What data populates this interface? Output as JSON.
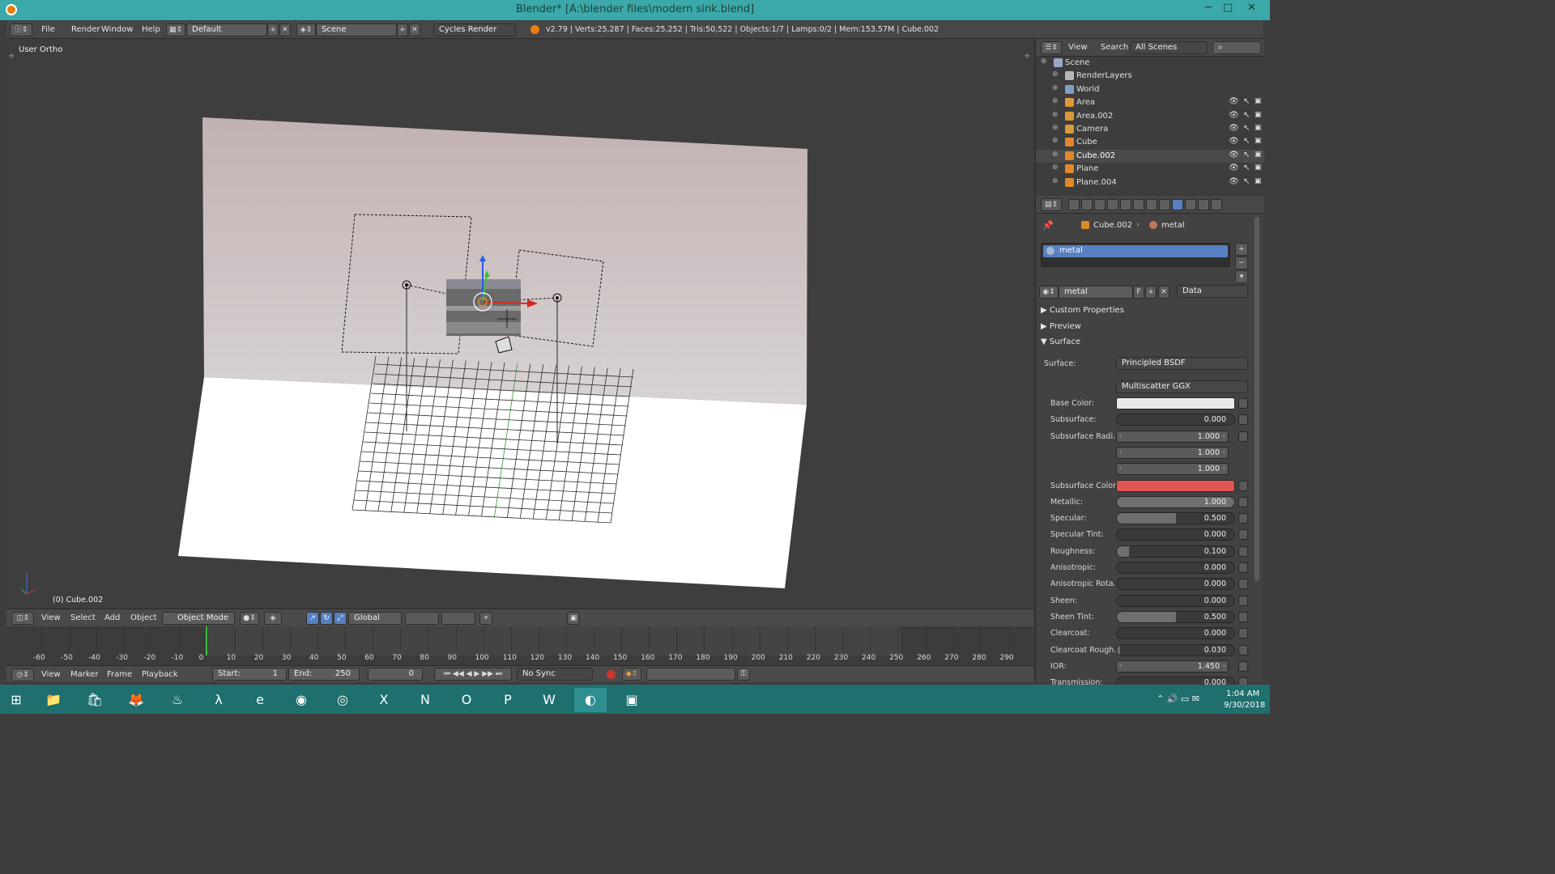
{
  "window": {
    "title": "Blender* [A:\\blender files\\modern sink.blend]",
    "min": "─",
    "max": "□",
    "close": "✕"
  },
  "menu": {
    "file": "File",
    "render": "Render",
    "window": "Window",
    "help": "Help"
  },
  "layout": {
    "value": "Default"
  },
  "scene": {
    "value": "Scene"
  },
  "engine": {
    "value": "Cycles Render"
  },
  "stats": "v2.79 | Verts:25,287 | Faces:25,252 | Tris:50,522 | Objects:1/7 | Lamps:0/2 | Mem:153.57M | Cube.002",
  "viewport": {
    "view_label": "User Ortho",
    "active_label": "(0) Cube.002"
  },
  "view3d_header": {
    "view": "View",
    "select": "Select",
    "add": "Add",
    "object": "Object",
    "mode": "Object Mode",
    "orientation": "Global"
  },
  "timeline": {
    "ticks": [
      "-60",
      "-50",
      "-40",
      "-30",
      "-20",
      "-10",
      "0",
      "10",
      "20",
      "30",
      "40",
      "50",
      "60",
      "70",
      "80",
      "90",
      "100",
      "110",
      "120",
      "130",
      "140",
      "150",
      "160",
      "170",
      "180",
      "190",
      "200",
      "210",
      "220",
      "230",
      "240",
      "250",
      "260",
      "270",
      "280",
      "290"
    ],
    "header": {
      "view": "View",
      "marker": "Marker",
      "frame": "Frame",
      "playback": "Playback",
      "start_label": "Start:",
      "start": "1",
      "end_label": "End:",
      "end": "250",
      "current": "0",
      "sync": "No Sync"
    }
  },
  "outliner": {
    "view": "View",
    "search": "Search",
    "filter": "All Scenes",
    "items": [
      {
        "label": "Scene",
        "icon": "scene-icon",
        "color": "#9aa8c4"
      },
      {
        "label": "RenderLayers",
        "icon": "render-layers-icon",
        "color": "#b7b7b7"
      },
      {
        "label": "World",
        "icon": "world-icon",
        "color": "#7fa0c8"
      },
      {
        "label": "Area",
        "icon": "lamp-icon",
        "color": "#d99a3a"
      },
      {
        "label": "Area.002",
        "icon": "lamp-icon",
        "color": "#d99a3a"
      },
      {
        "label": "Camera",
        "icon": "camera-icon",
        "color": "#d99a3a"
      },
      {
        "label": "Cube",
        "icon": "mesh-icon",
        "color": "#e0892a"
      },
      {
        "label": "Cube.002",
        "icon": "mesh-icon",
        "color": "#e0892a"
      },
      {
        "label": "Plane",
        "icon": "mesh-icon",
        "color": "#e0892a"
      },
      {
        "label": "Plane.004",
        "icon": "mesh-icon",
        "color": "#e0892a"
      }
    ]
  },
  "properties": {
    "breadcrumb": {
      "object": "Cube.002",
      "material": "metal"
    },
    "slot": "metal",
    "material_name": "metal",
    "fake_user": "F",
    "link": "Data",
    "panels": {
      "custom": "Custom Properties",
      "preview": "Preview",
      "surface": "Surface"
    },
    "surface_label": "Surface:",
    "surface_value": "Principled BSDF",
    "distribution": "Multiscatter GGX",
    "colors": {
      "base": "#e8e8e8",
      "subsurface": "#e05454",
      "accent": "#5680c2"
    },
    "rows": [
      {
        "label": "Base Color:",
        "type": "color",
        "key": "base"
      },
      {
        "label": "Subsurface:",
        "value": "0.000",
        "fill": 0
      },
      {
        "label": "Subsurface Radi...",
        "value": "1.000",
        "type": "vector"
      },
      {
        "label": "",
        "value": "1.000",
        "type": "vector"
      },
      {
        "label": "",
        "value": "1.000",
        "type": "vector"
      },
      {
        "label": "Subsurface Color:",
        "type": "color",
        "key": "subsurface"
      },
      {
        "label": "Metallic:",
        "value": "1.000",
        "fill": 1
      },
      {
        "label": "Specular:",
        "value": "0.500",
        "fill": 0.5
      },
      {
        "label": "Specular Tint:",
        "value": "0.000",
        "fill": 0
      },
      {
        "label": "Roughness:",
        "value": "0.100",
        "fill": 0.1
      },
      {
        "label": "Anisotropic:",
        "value": "0.000",
        "fill": 0
      },
      {
        "label": "Anisotropic Rota...",
        "value": "0.000",
        "fill": 0
      },
      {
        "label": "Sheen:",
        "value": "0.000",
        "fill": 0
      },
      {
        "label": "Sheen Tint:",
        "value": "0.500",
        "fill": 0.5
      },
      {
        "label": "Clearcoat:",
        "value": "0.000",
        "fill": 0
      },
      {
        "label": "Clearcoat Rough...",
        "value": "0.030",
        "fill": 0.03
      },
      {
        "label": "IOR:",
        "value": "1.450",
        "type": "vector"
      },
      {
        "label": "Transmission:",
        "value": "0.000",
        "fill": 0
      }
    ]
  },
  "taskbar": {
    "time": "1:04 AM",
    "date": "9/30/2018",
    "apps": [
      {
        "name": "file-explorer-icon",
        "glyph": "📁"
      },
      {
        "name": "store-icon",
        "glyph": "🛍"
      },
      {
        "name": "firefox-icon",
        "glyph": "🦊"
      },
      {
        "name": "steam-icon",
        "glyph": "♨"
      },
      {
        "name": "half-life-icon",
        "glyph": "λ"
      },
      {
        "name": "ie-icon",
        "glyph": "e"
      },
      {
        "name": "chrome-icon",
        "glyph": "◉"
      },
      {
        "name": "chrome-canary-icon",
        "glyph": "◎"
      },
      {
        "name": "excel-icon",
        "glyph": "X"
      },
      {
        "name": "onenote-icon",
        "glyph": "N"
      },
      {
        "name": "outlook-icon",
        "glyph": "O"
      },
      {
        "name": "powerpoint-icon",
        "glyph": "P"
      },
      {
        "name": "word-icon",
        "glyph": "W"
      },
      {
        "name": "blender-icon",
        "glyph": "◐"
      },
      {
        "name": "photos-icon",
        "glyph": "▣"
      }
    ]
  }
}
